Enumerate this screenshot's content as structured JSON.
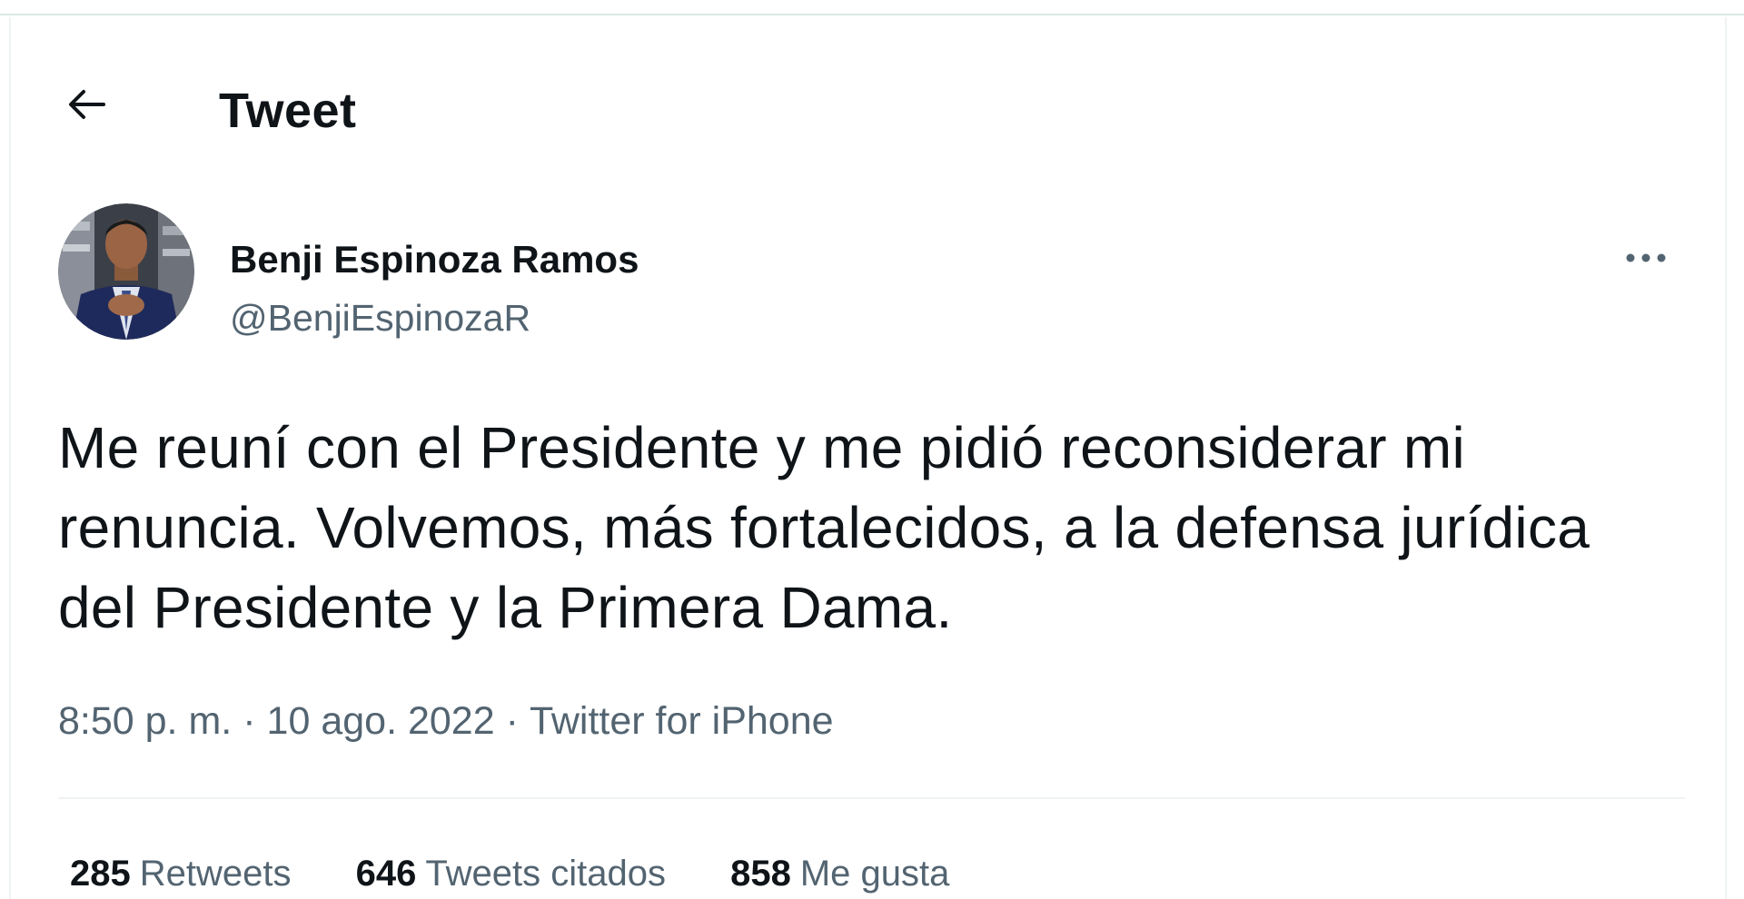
{
  "header": {
    "title": "Tweet",
    "back_icon": "arrow-left-icon"
  },
  "author": {
    "name": "Benji Espinoza Ramos",
    "handle": "@BenjiEspinozaR",
    "more_icon": "more-horizontal-icon"
  },
  "tweet": {
    "text": "Me reuní con el Presidente y me pidió reconsiderar mi renuncia. Volvemos, más fortalecidos, a la defensa jurídica del Presidente y la Primera Dama.",
    "time": "8:50 p. m.",
    "date": "10 ago. 2022",
    "source": "Twitter for iPhone",
    "separator": "·"
  },
  "stats": {
    "retweets": {
      "count": "285",
      "label": "Retweets"
    },
    "quotes": {
      "count": "646",
      "label": "Tweets citados"
    },
    "likes": {
      "count": "858",
      "label": "Me gusta"
    }
  },
  "colors": {
    "text": "#0f1419",
    "secondary": "#536471",
    "border": "#eff3f4"
  }
}
